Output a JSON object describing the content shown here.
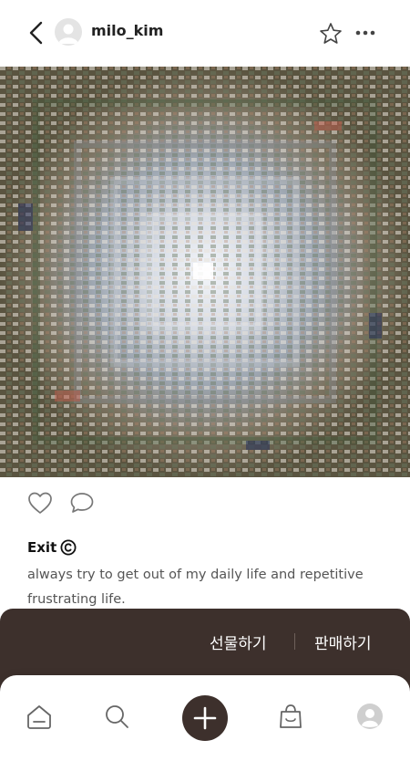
{
  "header": {
    "username": "milo_kim"
  },
  "post": {
    "title": "Exit",
    "description": "always try to get out of my daily life and repetitive frustrating life."
  },
  "sheet": {
    "gift_label": "선물하기",
    "sell_label": "판매하기"
  },
  "icons": {
    "back": "chevron-left-icon",
    "avatar": "user-avatar-icon",
    "favorite": "star-icon",
    "more": "more-dots-icon",
    "like": "heart-icon",
    "comment": "comment-icon",
    "copyright": "copyright-icon",
    "home": "home-icon",
    "search": "search-icon",
    "add": "plus-icon",
    "shop": "shopping-bag-icon",
    "profile": "profile-icon"
  },
  "colors": {
    "accent": "#3d302c",
    "icon": "#666666"
  }
}
